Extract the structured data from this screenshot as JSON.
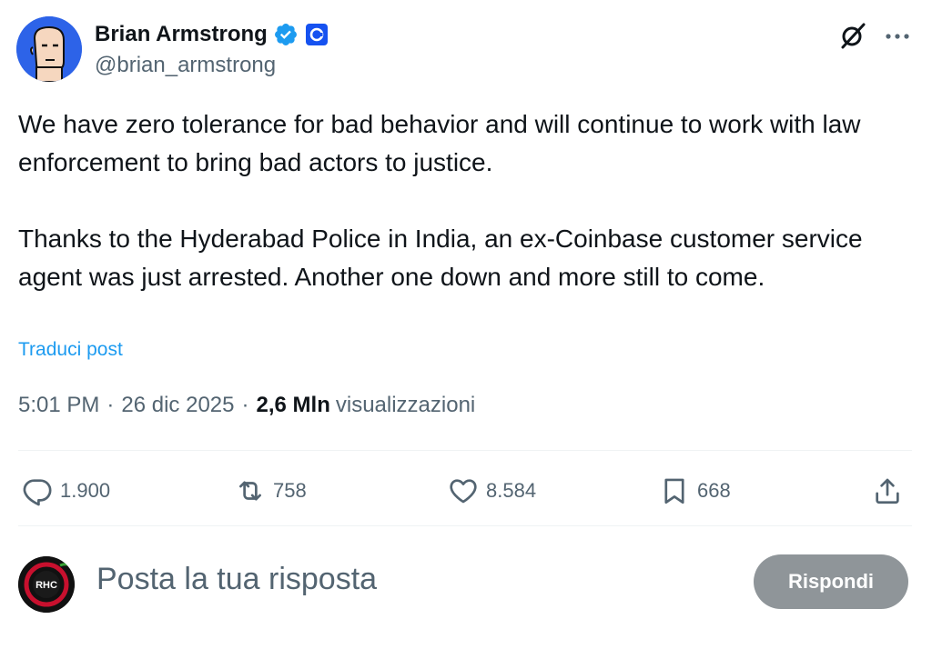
{
  "author": {
    "name": "Brian Armstrong",
    "handle": "@brian_armstrong",
    "verified_icon": "verified-badge-icon",
    "affiliate_icon": "coinbase-logo-icon"
  },
  "post": {
    "text": "We have zero tolerance for bad behavior and will continue to work with law enforcement to bring bad actors to justice.\n\nThanks to the Hyderabad Police in India, an ex-Coinbase customer service agent was just arrested. Another one down and more still to come.",
    "translate_label": "Traduci post",
    "time": "5:01 PM",
    "date": "26 dic 2025",
    "views_count": "2,6 Mln",
    "views_label": "visualizzazioni"
  },
  "actions": {
    "replies": "1.900",
    "reposts": "758",
    "likes": "8.584",
    "bookmarks": "668"
  },
  "reply_box": {
    "avatar_text": "RHC",
    "placeholder": "Posta la tua risposta",
    "button_label": "Rispondi"
  },
  "colors": {
    "accent": "#1d9bf0",
    "secondary_text": "#536471",
    "button_disabled": "#8f9599",
    "coinbase_blue": "#1652f0"
  }
}
